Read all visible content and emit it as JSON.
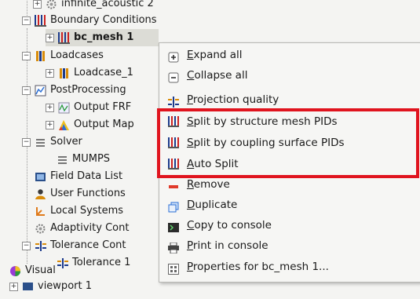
{
  "tree": {
    "infinite_acoustic": "infinite_acoustic 2",
    "boundary_conditions": "Boundary Conditions",
    "bc_mesh": "bc_mesh 1",
    "loadcases": "Loadcases",
    "loadcase": "Loadcase_1",
    "postprocessing": "PostProcessing",
    "output_frf": "Output FRF",
    "output_map": "Output Map",
    "solver": "Solver",
    "mumps": "MUMPS",
    "field_data": "Field Data List",
    "user_functions": "User Functions",
    "local_systems": "Local Systems",
    "adaptivity": "Adaptivity Cont",
    "tolerance_cont": "Tolerance Cont",
    "tolerance": "Tolerance 1",
    "visual": "Visual",
    "viewport": "viewport 1"
  },
  "menu": {
    "items": [
      {
        "label_u": "E",
        "label_rest": "xpand all",
        "icon": "expand-icon"
      },
      {
        "label_u": "C",
        "label_rest": "ollapse all",
        "icon": "collapse-icon"
      },
      {
        "label_u": "P",
        "label_rest": "rojection quality",
        "icon": "projection-quality-icon"
      },
      {
        "label_u": "S",
        "label_rest": "plit by structure mesh PIDs",
        "icon": "split-icon"
      },
      {
        "label_u": "S",
        "label_rest": "plit by coupling surface PIDs",
        "icon": "split-icon"
      },
      {
        "label_u": "A",
        "label_rest": "uto Split",
        "icon": "split-icon"
      },
      {
        "label_u": "R",
        "label_rest": "emove",
        "icon": "remove-icon"
      },
      {
        "label_u": "D",
        "label_rest": "uplicate",
        "icon": "duplicate-icon"
      },
      {
        "label_u": "C",
        "label_rest": "opy to console",
        "icon": "console-icon"
      },
      {
        "label_u": "P",
        "label_rest": "rint in console",
        "icon": "print-icon"
      },
      {
        "label_u": "P",
        "label_rest": "roperties for bc_mesh 1...",
        "icon": "properties-icon"
      }
    ]
  },
  "colors": {
    "highlight": "#e0141e",
    "remove": "#e03a2a",
    "accent": "#1d3b8c"
  }
}
